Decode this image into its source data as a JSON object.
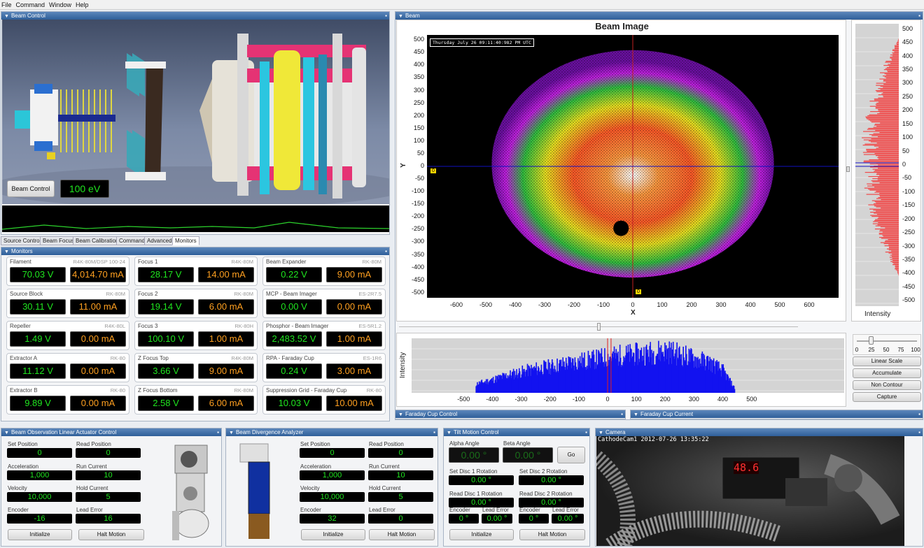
{
  "menu": [
    "File",
    "Command",
    "Window",
    "Help"
  ],
  "beam_control": {
    "title": "Beam Control",
    "button": "Beam Control",
    "energy": "100 eV",
    "tabs": [
      "Source Control",
      "Beam Focus",
      "Beam Calibration",
      "Command",
      "Advanced",
      "Monitors"
    ],
    "active_tab": "Monitors"
  },
  "monitors": {
    "title": "Monitors",
    "cards": [
      {
        "label": "Filament",
        "model": "R4K-80M/DSP 100-24",
        "v": "70.03 V",
        "a": "4,014.70 mA"
      },
      {
        "label": "Focus 1",
        "model": "R4K-80M",
        "v": "28.17 V",
        "a": "14.00 mA"
      },
      {
        "label": "Beam Expander",
        "model": "RK-80M",
        "v": "0.22 V",
        "a": "9.00 mA"
      },
      {
        "label": "Source Block",
        "model": "RK-80M",
        "v": "30.11 V",
        "a": "11.00 mA"
      },
      {
        "label": "Focus 2",
        "model": "RK-80M",
        "v": "19.14 V",
        "a": "6.00 mA"
      },
      {
        "label": "MCP - Beam Imager",
        "model": "ES-2R7.5",
        "v": "0.00 V",
        "a": "0.00 mA"
      },
      {
        "label": "Repeller",
        "model": "R4K-80L",
        "v": "1.49 V",
        "a": "0.00 mA"
      },
      {
        "label": "Focus 3",
        "model": "RK-80H",
        "v": "100.10 V",
        "a": "1.00 mA"
      },
      {
        "label": "Phosphor - Beam Imager",
        "model": "ES-5R1.2",
        "v": "2,483.52 V",
        "a": "1.00 mA"
      },
      {
        "label": "Extractor A",
        "model": "RK-80",
        "v": "11.12 V",
        "a": "0.00 mA"
      },
      {
        "label": "Z Focus Top",
        "model": "R4K-80M",
        "v": "3.66 V",
        "a": "9.00 mA"
      },
      {
        "label": "RPA - Faraday Cup",
        "model": "ES-1R6",
        "v": "0.24 V",
        "a": "3.00 mA"
      },
      {
        "label": "Extractor B",
        "model": "RK-80",
        "v": "9.89 V",
        "a": "0.00 mA"
      },
      {
        "label": "Z Focus Bottom",
        "model": "RK-80M",
        "v": "2.58 V",
        "a": "6.00 mA"
      },
      {
        "label": "Suppression Grid - Faraday Cup",
        "model": "RK-80",
        "v": "10.03 V",
        "a": "10.00 mA"
      }
    ]
  },
  "beam": {
    "panel_title": "Beam",
    "chart_title": "Beam Image",
    "timestamp": "Thursday July 26 09:11:40:982 PM UTC",
    "xlabel": "X",
    "ylabel": "Y",
    "x_ticks": [
      "-600",
      "-500",
      "-400",
      "-300",
      "-200",
      "-100",
      "0",
      "100",
      "200",
      "300",
      "400",
      "500",
      "600"
    ],
    "y_ticks": [
      "500",
      "450",
      "400",
      "350",
      "300",
      "250",
      "200",
      "150",
      "100",
      "50",
      "0",
      "-50",
      "-100",
      "-150",
      "-200",
      "-250",
      "-300",
      "-350",
      "-400",
      "-450",
      "-500"
    ],
    "marker_x": "0",
    "marker_y": "0",
    "side_label": "Intensity",
    "bottom_label": "Intensity",
    "scale_ticks": [
      "0",
      "25",
      "50",
      "75",
      "100"
    ],
    "buttons": [
      "Linear Scale",
      "Accumulate",
      "Non Contour",
      "Capture"
    ]
  },
  "chart_data": [
    {
      "type": "heatmap",
      "title": "Beam Image",
      "xlabel": "X",
      "ylabel": "Y",
      "xlim": [
        -700,
        700
      ],
      "ylim": [
        -520,
        520
      ],
      "note_shape": "ellipse",
      "center": [
        0,
        10
      ],
      "radius_x": 480,
      "radius_y": 450
    },
    {
      "type": "bar",
      "title": "",
      "ylabel": "Intensity",
      "xlim": [
        -700,
        700
      ],
      "x": [
        -460,
        -400,
        -350,
        -300,
        -250,
        -200,
        -150,
        -100,
        -50,
        0,
        50,
        100,
        150,
        200,
        250,
        300,
        350,
        400,
        440
      ],
      "values": [
        20,
        30,
        40,
        48,
        55,
        60,
        66,
        72,
        76,
        82,
        86,
        88,
        92,
        96,
        88,
        78,
        70,
        50,
        10
      ]
    }
  ],
  "faraday_control": {
    "title": "Faraday Cup Control"
  },
  "faraday_current": {
    "title": "Faraday Cup Current"
  },
  "actuator": {
    "title": "Beam Observation Linear Actuator Control",
    "fields": [
      {
        "label": "Set Position",
        "value": "0"
      },
      {
        "label": "Read Position",
        "value": "0"
      },
      {
        "label": "Acceleration",
        "value": "1,000"
      },
      {
        "label": "Run Current",
        "value": "10"
      },
      {
        "label": "Velocity",
        "value": "10,000"
      },
      {
        "label": "Hold Current",
        "value": "5"
      },
      {
        "label": "Encoder",
        "value": "-16"
      },
      {
        "label": "Lead Error",
        "value": "16"
      }
    ],
    "btn_init": "Initialize",
    "btn_halt": "Halt Motion"
  },
  "divergence": {
    "title": "Beam Divergence Analyzer",
    "fields": [
      {
        "label": "Set Position",
        "value": "0"
      },
      {
        "label": "Read Position",
        "value": "0"
      },
      {
        "label": "Acceleration",
        "value": "1,000"
      },
      {
        "label": "Run Current",
        "value": "10"
      },
      {
        "label": "Velocity",
        "value": "10,000"
      },
      {
        "label": "Hold Current",
        "value": "5"
      },
      {
        "label": "Encoder",
        "value": "32"
      },
      {
        "label": "Lead Error",
        "value": "0"
      }
    ],
    "btn_init": "Initialize",
    "btn_halt": "Halt Motion"
  },
  "tilt": {
    "title": "Tilt Motion Control",
    "alpha_label": "Alpha Angle",
    "alpha": "0.00 °",
    "beta_label": "Beta Angle",
    "beta": "0.00 °",
    "go": "Go",
    "set1_label": "Set Disc 1 Rotation",
    "set1": "0.00 °",
    "set2_label": "Set Disc 2 Rotation",
    "set2": "0.00 °",
    "read1_label": "Read Disc 1 Rotation",
    "read1": "0.00 °",
    "read2_label": "Read Disc 2 Rotation",
    "read2": "0.00 °",
    "enc_label": "Encoder",
    "lead_label": "Lead Error",
    "enc1": "0 °",
    "lead1": "0.00 °",
    "enc2": "0 °",
    "lead2": "0.00 °",
    "btn_init": "Initialize",
    "btn_halt": "Halt Motion"
  },
  "camera": {
    "title": "Camera",
    "overlay": "CathodeCam1 2012-07-26 13:35:22",
    "display": "48.6"
  }
}
